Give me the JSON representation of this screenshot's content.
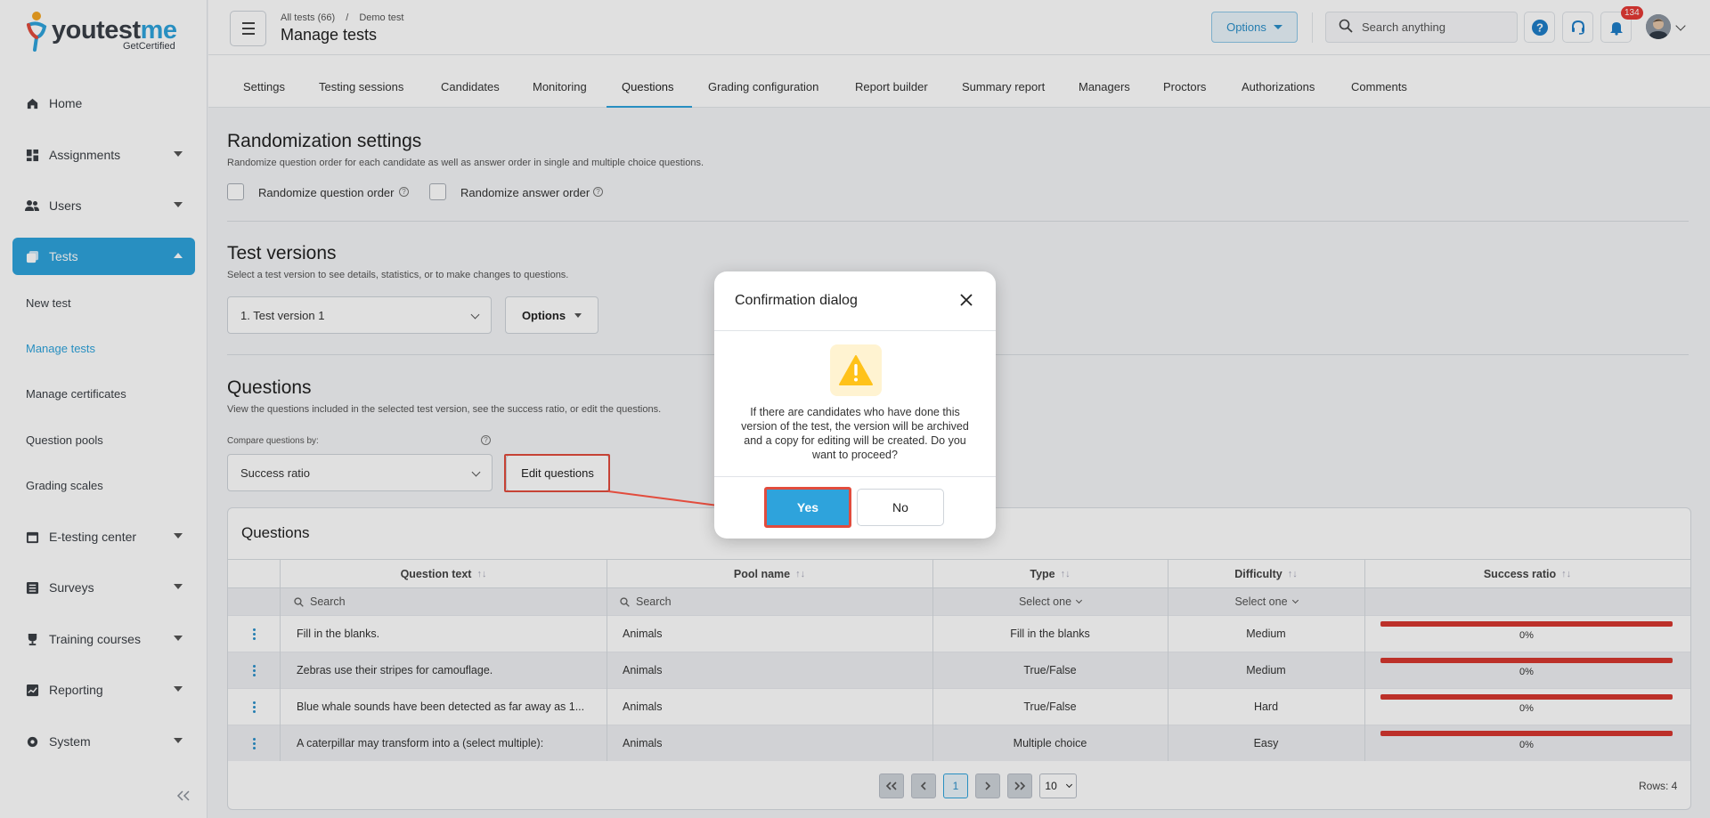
{
  "brand": {
    "word_a": "youtest",
    "word_b": "me",
    "sub": "GetCertified"
  },
  "sidebar": {
    "items": [
      {
        "label": "Home",
        "icon": "home-icon"
      },
      {
        "label": "Assignments",
        "icon": "dashboard-icon"
      },
      {
        "label": "Users",
        "icon": "users-icon"
      },
      {
        "label": "Tests",
        "icon": "tests-icon"
      },
      {
        "label": "E-testing center",
        "icon": "calendar-icon"
      },
      {
        "label": "Surveys",
        "icon": "list-icon"
      },
      {
        "label": "Training courses",
        "icon": "trophy-icon"
      },
      {
        "label": "Reporting",
        "icon": "chart-icon"
      },
      {
        "label": "System",
        "icon": "gear-icon"
      }
    ],
    "sub_items": [
      "New test",
      "Manage tests",
      "Manage certificates",
      "Question pools",
      "Grading scales"
    ]
  },
  "header": {
    "crumb_a": "All tests (66)",
    "crumb_sep": "/",
    "crumb_b": "Demo test",
    "title": "Manage tests",
    "options_label": "Options",
    "search_placeholder": "Search anything",
    "notif_count": "134"
  },
  "tabs": [
    "Settings",
    "Testing sessions",
    "Candidates",
    "Monitoring",
    "Questions",
    "Grading configuration",
    "Report builder",
    "Summary report",
    "Managers",
    "Proctors",
    "Authorizations",
    "Comments"
  ],
  "randomization": {
    "title": "Randomization settings",
    "desc": "Randomize question order for each candidate as well as answer order in single and multiple choice questions.",
    "opt1": "Randomize question order",
    "opt2": "Randomize answer order"
  },
  "versions": {
    "title": "Test versions",
    "desc": "Select a test version to see details, statistics, or to make changes to questions.",
    "selected": "1. Test version 1",
    "options_label": "Options"
  },
  "questions_section": {
    "title": "Questions",
    "desc": "View the questions included in the selected test version, see the success ratio, or edit the questions.",
    "compare_label": "Compare questions by:",
    "compare_value": "Success ratio",
    "edit_label": "Edit questions"
  },
  "table": {
    "card_title": "Questions",
    "headers": [
      "Question text",
      "Pool name",
      "Type",
      "Difficulty",
      "Success ratio"
    ],
    "sort_glyph": "↑↓",
    "search_placeholder": "Search",
    "select_one": "Select one",
    "rows": [
      {
        "text": "Fill in the blanks.",
        "pool": "Animals",
        "type": "Fill in the blanks",
        "difficulty": "Medium",
        "ratio": 0,
        "ratio_label": "0%"
      },
      {
        "text": "Zebras use their stripes for camouflage.",
        "pool": "Animals",
        "type": "True/False",
        "difficulty": "Medium",
        "ratio": 0,
        "ratio_label": "0%"
      },
      {
        "text": "Blue whale sounds have been detected as far away as 1...",
        "pool": "Animals",
        "type": "True/False",
        "difficulty": "Hard",
        "ratio": 0,
        "ratio_label": "0%"
      },
      {
        "text": "A caterpillar may transform into a (select multiple):",
        "pool": "Animals",
        "type": "Multiple choice",
        "difficulty": "Easy",
        "ratio": 0,
        "ratio_label": "0%"
      }
    ],
    "page_current": "1",
    "page_size": "10",
    "rows_label": "Rows: 4"
  },
  "dialog": {
    "title": "Confirmation dialog",
    "message": "If there are candidates who have done this version of the test, the version will be archived and a copy for editing will be created. Do you want to proceed?",
    "yes": "Yes",
    "no": "No"
  },
  "colors": {
    "accent": "#2ea3dc",
    "highlight": "#e24c3d",
    "bar": "#d7372f"
  }
}
